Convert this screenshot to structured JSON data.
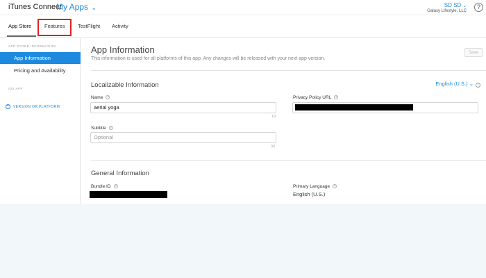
{
  "header": {
    "brand": "iTunes Connect",
    "section": "My Apps",
    "account_name": "SD SD",
    "account_org": "Galaxy Lifestyle, LLC",
    "help": "?"
  },
  "tabs": [
    {
      "label": "App Store"
    },
    {
      "label": "Features"
    },
    {
      "label": "TestFlight"
    },
    {
      "label": "Activity"
    }
  ],
  "sidebar": {
    "section1": "APP STORE INFORMATION",
    "items": [
      {
        "label": "App Information"
      },
      {
        "label": "Pricing and Availability"
      }
    ],
    "section2": "iOS APP",
    "add_label": "VERSION OR PLATFORM"
  },
  "main": {
    "title": "App Information",
    "subtitle": "This information is used for all platforms of this app. Any changes will be released with your next app version.",
    "save_label": "Save",
    "localizable": {
      "title": "Localizable Information",
      "language": "English (U.S.)",
      "name_label": "Name",
      "name_value": "aerial yoga",
      "name_remaining": "19",
      "subtitle_label": "Subtitle",
      "subtitle_placeholder": "Optional",
      "subtitle_remaining": "30",
      "privacy_label": "Privacy Policy URL"
    },
    "general": {
      "title": "General Information",
      "bundle_label": "Bundle ID",
      "primary_lang_label": "Primary Language",
      "primary_lang_value": "English (U.S.)"
    }
  },
  "colors": {
    "accent": "#1d8ae0",
    "highlight": "#e21f1f"
  }
}
